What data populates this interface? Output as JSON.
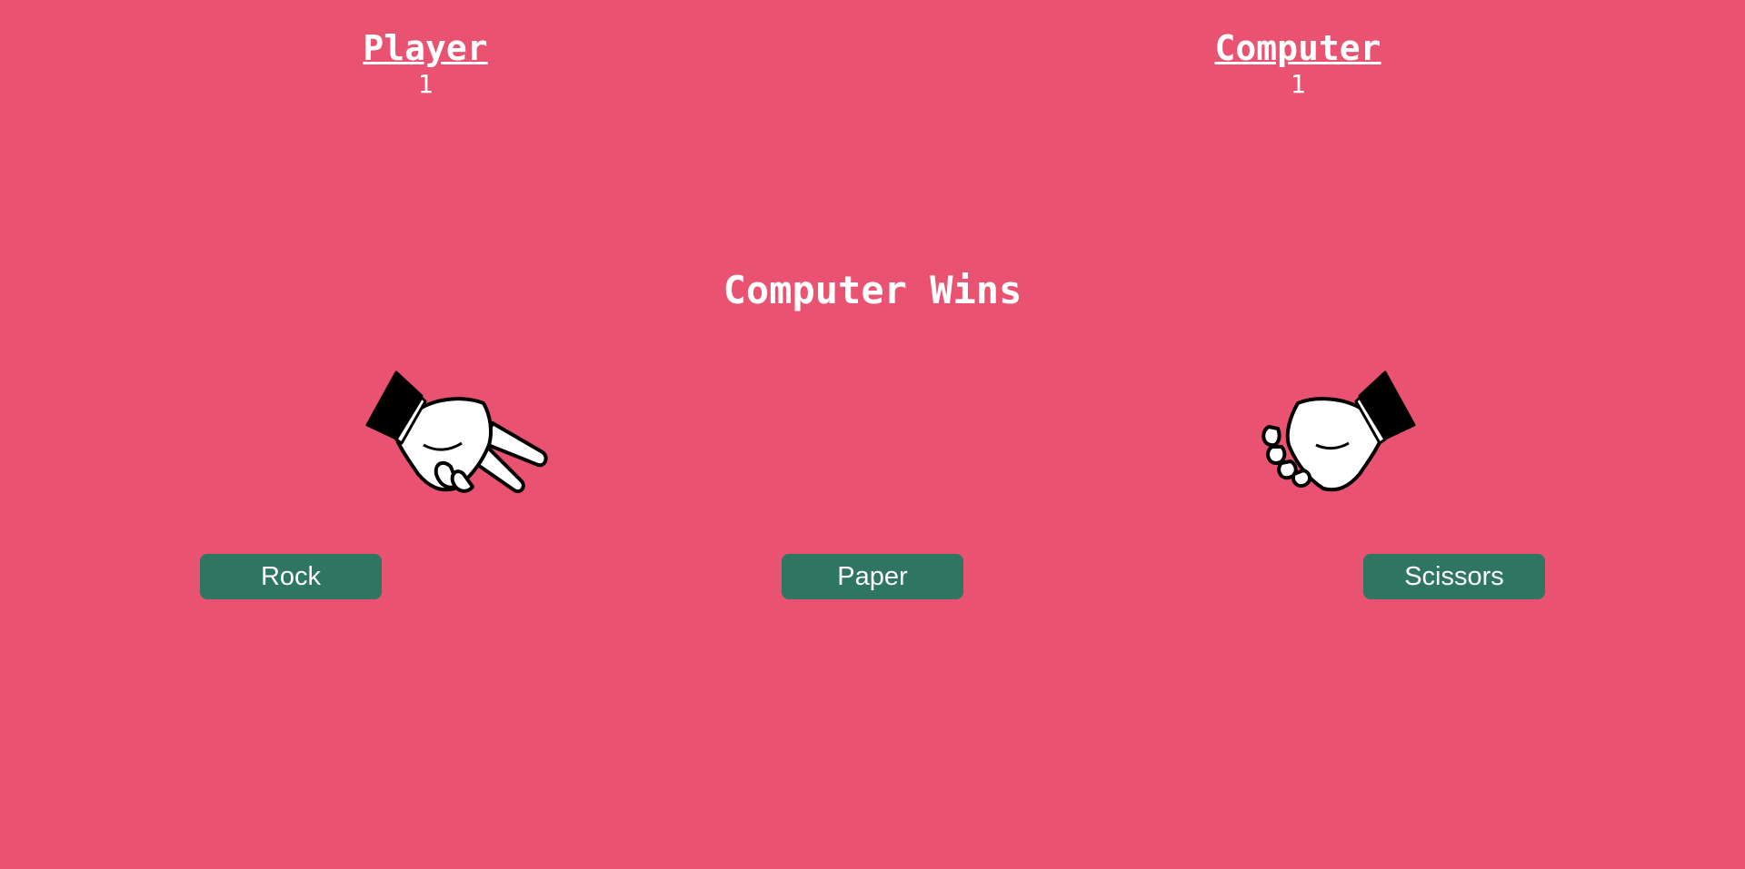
{
  "player": {
    "label": "Player",
    "score": "1",
    "hand_icon": "scissors-hand-icon"
  },
  "computer": {
    "label": "Computer",
    "score": "1",
    "hand_icon": "rock-fist-icon"
  },
  "result": "Computer Wins",
  "choices": {
    "rock": "Rock",
    "paper": "Paper",
    "scissors": "Scissors"
  },
  "colors": {
    "background": "#e95371",
    "button": "#2e7662",
    "text": "#ffffff"
  }
}
